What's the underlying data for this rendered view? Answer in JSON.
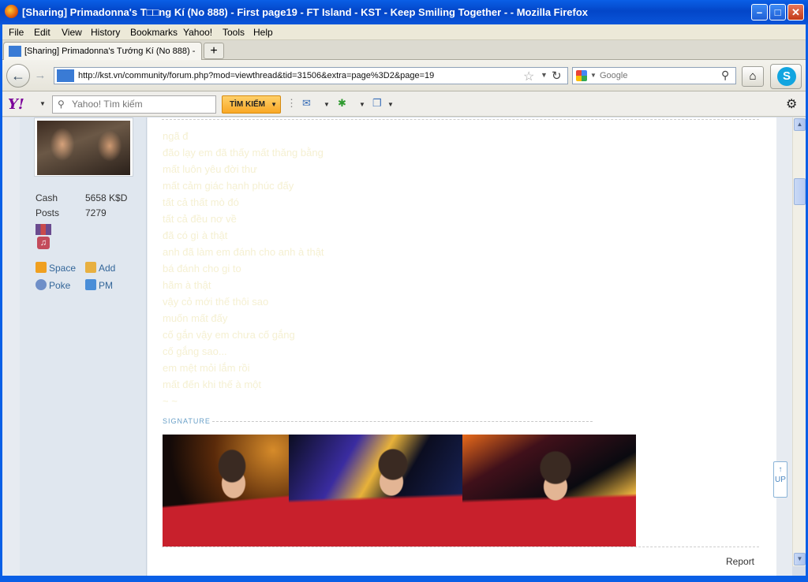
{
  "window": {
    "title": "[Sharing] Primadonna's T□□ng Kí (No 888) - First page19 - FT Island - KST - Keep Smiling Together - - Mozilla Firefox",
    "minimize": "–",
    "maximize": "□",
    "close": "✕"
  },
  "menu": [
    "File",
    "Edit",
    "View",
    "History",
    "Bookmarks",
    "Yahoo!",
    "Tools",
    "Help"
  ],
  "tab": {
    "label": "[Sharing] Primadonna's Tướng Kí (No 888) - ...",
    "new_tab": "+"
  },
  "nav": {
    "url": "http://kst.vn/community/forum.php?mod=viewthread&tid=31506&extra=page%3D2&page=19",
    "search_placeholder": "Google"
  },
  "yahoo": {
    "logo": "Y!",
    "search_placeholder": "Yahoo! Tìm kiếm",
    "search_button": "TÌM KIẾM"
  },
  "profile": {
    "cash_label": "Cash",
    "cash_value": "5658 K$D",
    "posts_label": "Posts",
    "posts_value": "7279",
    "actions": {
      "space": "Space",
      "add": "Add",
      "poke": "Poke",
      "pm": "PM"
    }
  },
  "post": {
    "lines": [
      "ngã đ",
      "đão lạy em đã thấy mất thăng bằng",
      "mất luôn yêu đời thư",
      "mất cảm giác hạnh phúc đấy",
      "tất cả thất mò đó",
      "tất cả đều nơ về",
      "đã có gì à thật",
      "anh đã làm em đánh cho anh à thật",
      "bá đánh cho gi to",
      "hãm à thật",
      "vậy cỏ mới thế thôi sao",
      "muốn mất đấy",
      "cố gắn vậy em chưa cố gắng",
      "cố gắng sao...",
      "em mệt mỏi lắm rồi",
      "mất đến khi thế à một",
      "~ ~"
    ],
    "signature_label": "SIGNATURE",
    "report": "Report"
  },
  "up_button": "UP",
  "colors": {
    "post_text": "#f5f0d2",
    "link": "#336699",
    "titlebar": "#0a5fe6"
  }
}
